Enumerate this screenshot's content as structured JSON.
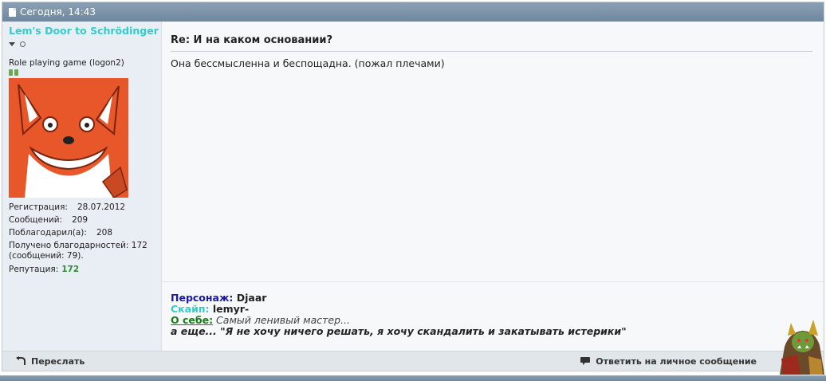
{
  "header": {
    "timestamp": "Сегодня, 14:43"
  },
  "user": {
    "name": "Lem's Door to Schrödinger",
    "rank": "Role playing game (logon2)",
    "stats": {
      "reg_label": "Регистрация:",
      "reg_value": "28.07.2012",
      "msgs_label": "Сообщений:",
      "msgs_value": "209",
      "thanked_label": "Поблагодарил(а):",
      "thanked_value": "208",
      "received": "Получено благодарностей: 172 (сообщений: 79).",
      "rep_label": "Репутация:",
      "rep_value": "172"
    }
  },
  "post": {
    "title": "Re: И на каком основании?",
    "body": "Она бессмысленна и беспощадна. (пожал плечами)"
  },
  "signature": {
    "char_label": "Персонаж:",
    "char_value": " Djaar",
    "skype_label": "Скайп:",
    "skype_value": " lemyr-",
    "about_label": "О себе:",
    "about_value": " Самый ленивый мастер...",
    "quote": "а еще... \"Я не хочу ничего решать, я хочу скандалить и закатывать истерики\""
  },
  "footer": {
    "forward_label": "Переслать",
    "reply_pm_label": "Ответить на личное сообщение"
  },
  "colors": {
    "header_bg": "#7a91a7",
    "username": "#33cccc",
    "reputation": "#2e8b2e"
  }
}
